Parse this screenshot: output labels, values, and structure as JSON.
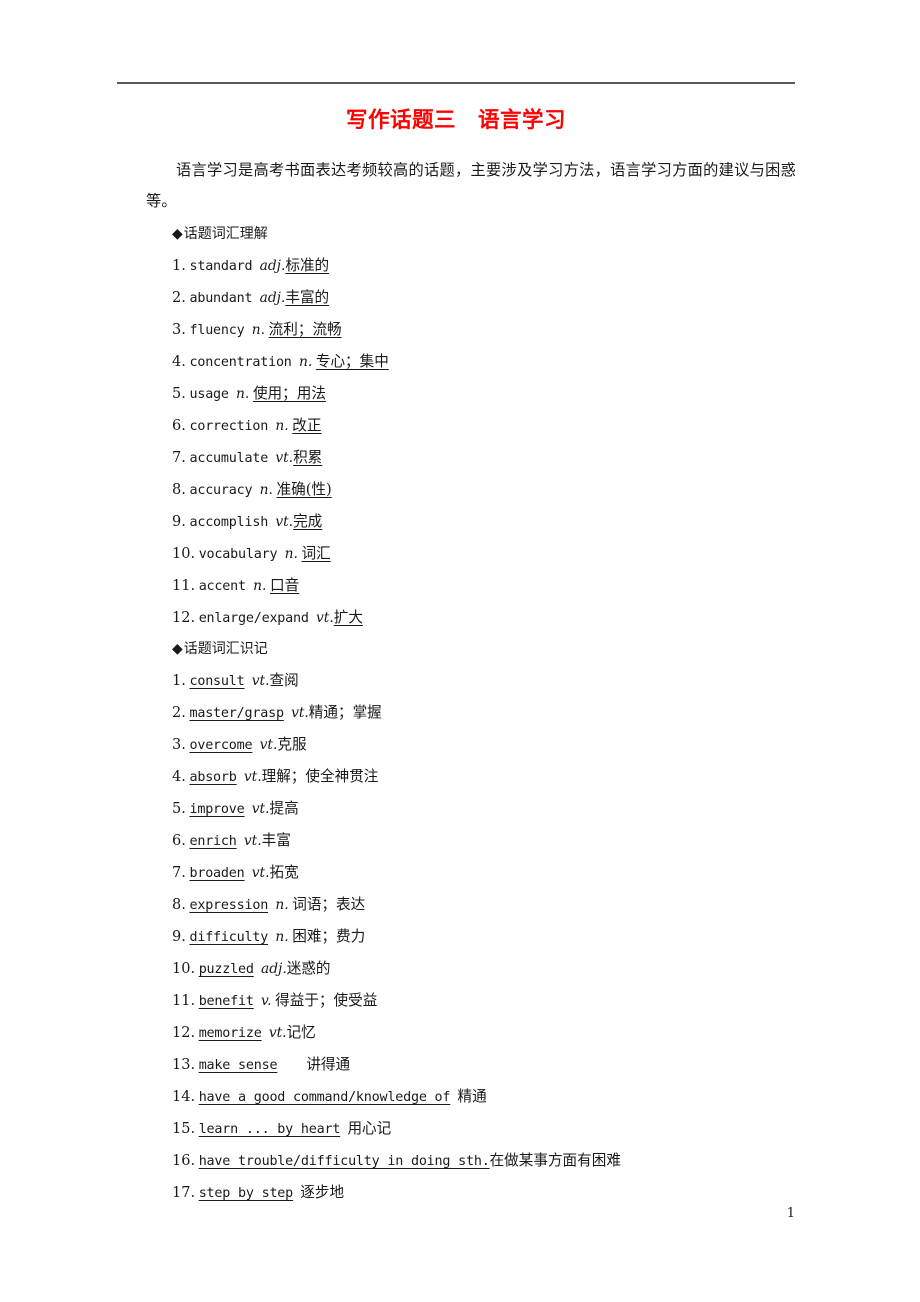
{
  "document": {
    "title": "写作话题三　语言学习",
    "title_color": "#ff0000",
    "page_number": "1",
    "intro": "语言学习是高考书面表达考频较高的话题，主要涉及学习方法，语言学习方面的建议与困惑等。"
  },
  "sections": [
    {
      "heading_marker": "◆",
      "heading": "话题词汇理解",
      "underline_target": "chinese",
      "entries": [
        {
          "num": "1.",
          "en": "standard",
          "pos": "adj.",
          "zh": "标准的"
        },
        {
          "num": "2.",
          "en": "abundant",
          "pos": "adj.",
          "zh": "丰富的"
        },
        {
          "num": "3.",
          "en": "fluency",
          "pos": "n.",
          "zh": "流利；流畅"
        },
        {
          "num": "4.",
          "en": "concentration",
          "pos": "n.",
          "zh": "专心；集中"
        },
        {
          "num": "5.",
          "en": "usage",
          "pos": "n.",
          "zh": "使用；用法"
        },
        {
          "num": "6.",
          "en": "correction",
          "pos": "n.",
          "zh": "改正"
        },
        {
          "num": "7.",
          "en": "accumulate",
          "pos": "vt.",
          "zh": "积累"
        },
        {
          "num": "8.",
          "en": "accuracy",
          "pos": "n.",
          "zh": "准确(性)"
        },
        {
          "num": "9.",
          "en": "accomplish",
          "pos": "vt.",
          "zh": "完成"
        },
        {
          "num": "10.",
          "en": "vocabulary",
          "pos": "n.",
          "zh": "词汇"
        },
        {
          "num": "11.",
          "en": "accent",
          "pos": "n.",
          "zh": "口音"
        },
        {
          "num": "12.",
          "en": "enlarge/expand",
          "pos": "vt.",
          "zh": "扩大"
        }
      ]
    },
    {
      "heading_marker": "◆",
      "heading": "话题词汇识记",
      "underline_target": "english",
      "entries": [
        {
          "num": "1.",
          "en": "consult",
          "pos": "vt.",
          "zh": "查阅"
        },
        {
          "num": "2.",
          "en": "master/grasp",
          "pos": "vt.",
          "zh": "精通；掌握"
        },
        {
          "num": "3.",
          "en": "overcome",
          "pos": "vt.",
          "zh": "克服"
        },
        {
          "num": "4.",
          "en": "absorb",
          "pos": "vt.",
          "zh": "理解；使全神贯注"
        },
        {
          "num": "5.",
          "en": "improve",
          "pos": "vt.",
          "zh": "提高"
        },
        {
          "num": "6.",
          "en": "enrich",
          "pos": "vt.",
          "zh": "丰富"
        },
        {
          "num": "7.",
          "en": "broaden",
          "pos": "vt.",
          "zh": "拓宽"
        },
        {
          "num": "8.",
          "en": "expression",
          "pos": "n.",
          "zh": "词语；表达"
        },
        {
          "num": "9.",
          "en": "difficulty",
          "pos": "n.",
          "zh": "困难；费力"
        },
        {
          "num": "10.",
          "en": "puzzled",
          "pos": "adj.",
          "zh": "迷惑的"
        },
        {
          "num": "11.",
          "en": "benefit",
          "pos": "v.",
          "zh": "得益于；使受益"
        },
        {
          "num": "12.",
          "en": "memorize",
          "pos": "vt.",
          "zh": "记忆"
        },
        {
          "num": "13.",
          "en": "make sense",
          "pos": "",
          "zh": "讲得通",
          "gap": "wide"
        },
        {
          "num": "14.",
          "en": "have a good command/knowledge of",
          "pos": "",
          "zh": "精通"
        },
        {
          "num": "15.",
          "en": "learn ... by heart",
          "pos": "",
          "zh": "用心记"
        },
        {
          "num": "16.",
          "en": "have trouble/difficulty in doing sth.",
          "pos": "",
          "zh": "在做某事方面有困难",
          "gap": "none"
        },
        {
          "num": "17.",
          "en": "step by step",
          "pos": "",
          "zh": "逐步地"
        }
      ]
    }
  ]
}
